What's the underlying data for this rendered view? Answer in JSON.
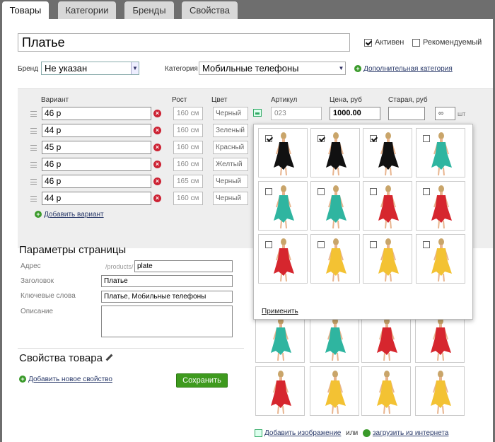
{
  "tabs": [
    {
      "label": "Товары",
      "active": true
    },
    {
      "label": "Категории",
      "active": false
    },
    {
      "label": "Бренды",
      "active": false
    },
    {
      "label": "Свойства",
      "active": false
    }
  ],
  "product": {
    "name": "Платье",
    "active_label": "Активен",
    "active_checked": true,
    "featured_label": "Рекомендуемый",
    "featured_checked": false
  },
  "brand": {
    "label": "Бренд",
    "value": "Не указан"
  },
  "category": {
    "label": "Категория",
    "value": "Мобильные телефоны",
    "add_link": "Дополнительная категория"
  },
  "variants": {
    "headers": {
      "variant": "Вариант",
      "height": "Рост",
      "color": "Цвет",
      "sku": "Артикул",
      "price": "Цена, руб",
      "old_price": "Старая, руб"
    },
    "rows": [
      {
        "name": "46 р",
        "height": "160 см",
        "color": "Черный",
        "sku": "023",
        "price": "1000.00",
        "old_price": "",
        "stock": "∞",
        "unit": "шт"
      },
      {
        "name": "44 р",
        "height": "160 см",
        "color": "Зеленый"
      },
      {
        "name": "45 р",
        "height": "160 см",
        "color": "Красный"
      },
      {
        "name": "46 р",
        "height": "160 см",
        "color": "Желтый"
      },
      {
        "name": "46 р",
        "height": "165 см",
        "color": "Черный"
      },
      {
        "name": "44 р",
        "height": "160 см",
        "color": "Черный"
      }
    ],
    "add_link": "Добавить вариант"
  },
  "page_params": {
    "title": "Параметры страницы",
    "address_label": "Адрес",
    "address_prefix": "/products/",
    "address_value": "plate",
    "heading_label": "Заголовок",
    "heading_value": "Платье",
    "keywords_label": "Ключевые слова",
    "keywords_value": "Платье, Мобильные телефоны",
    "description_label": "Описание",
    "description_value": ""
  },
  "properties": {
    "title": "Свойства товара",
    "add_link": "Добавить новое свойство"
  },
  "save_label": "Сохранить",
  "image_picker": {
    "apply_label": "Применить",
    "items": [
      {
        "color": "black",
        "checked": true
      },
      {
        "color": "black",
        "checked": true
      },
      {
        "color": "black",
        "checked": true
      },
      {
        "color": "teal",
        "checked": false
      },
      {
        "color": "teal",
        "checked": false
      },
      {
        "color": "teal",
        "checked": false
      },
      {
        "color": "red",
        "checked": false
      },
      {
        "color": "red",
        "checked": false
      },
      {
        "color": "red",
        "checked": false
      },
      {
        "color": "yellow",
        "checked": false
      },
      {
        "color": "yellow",
        "checked": false
      },
      {
        "color": "yellow",
        "checked": false
      }
    ]
  },
  "gallery": {
    "items": [
      {
        "color": "red"
      },
      {
        "color": "red"
      },
      {
        "color": "red"
      },
      {
        "color": "teal"
      },
      {
        "color": "teal"
      },
      {
        "color": "teal"
      },
      {
        "color": "red"
      },
      {
        "color": "red"
      },
      {
        "color": "red"
      },
      {
        "color": "yellow"
      },
      {
        "color": "yellow"
      },
      {
        "color": "yellow"
      }
    ],
    "add_image_link": "Добавить изображение",
    "or_label": "или",
    "upload_link": "загрузить из интернета"
  },
  "colors": {
    "black": "#111111",
    "teal": "#2fb5a0",
    "red": "#d6262e",
    "yellow": "#f3c233",
    "skin": "#e8b48e",
    "hair": "#c9a56a",
    "accent_green": "#3e9a1e",
    "delete_red": "#cc2233"
  }
}
